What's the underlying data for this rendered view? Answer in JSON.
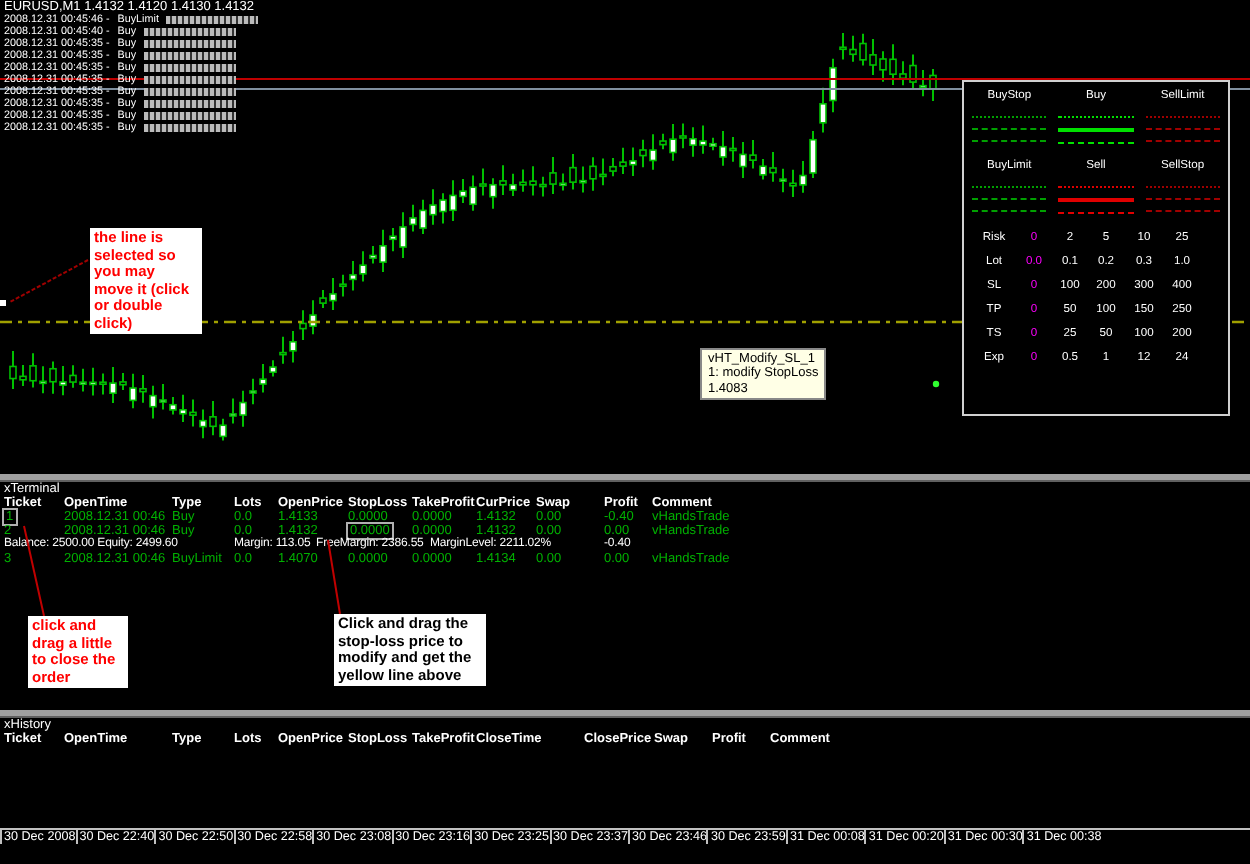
{
  "chart": {
    "header": "EURUSD,M1  1.4132 1.4120 1.4130 1.4132",
    "log": [
      {
        "time": "2008.12.31 00:45:46 -",
        "message": "BuyLimit"
      },
      {
        "time": "2008.12.31 00:45:40 -",
        "message": "Buy"
      },
      {
        "time": "2008.12.31 00:45:35 -",
        "message": "Buy"
      },
      {
        "time": "2008.12.31 00:45:35 -",
        "message": "Buy"
      },
      {
        "time": "2008.12.31 00:45:35 -",
        "message": "Buy"
      },
      {
        "time": "2008.12.31 00:45:35 -",
        "message": "Buy"
      },
      {
        "time": "2008.12.31 00:45:35 -",
        "message": "Buy"
      },
      {
        "time": "2008.12.31 00:45:35 -",
        "message": "Buy"
      },
      {
        "time": "2008.12.31 00:45:35 -",
        "message": "Buy"
      },
      {
        "time": "2008.12.31 00:45:35 -",
        "message": "Buy"
      }
    ],
    "notes": [
      {
        "kind": "callout",
        "color": "#ff0000",
        "text": "the line is selected so you may move it (click or double click)"
      },
      {
        "kind": "tooltip",
        "color": "#000000",
        "text": "vHT_Modify_SL_1\n1: modify StopLoss\n1.4083"
      }
    ],
    "panel": {
      "order_types": [
        {
          "label": "BuyStop",
          "color": "#00a000"
        },
        {
          "label": "Buy",
          "color": "#00e000"
        },
        {
          "label": "SellLimit",
          "color": "#a00000"
        },
        {
          "label": "BuyLimit",
          "color": "#00a000"
        },
        {
          "label": "Sell",
          "color": "#e00000"
        },
        {
          "label": "SellStop",
          "color": "#a00000"
        }
      ],
      "rows": [
        {
          "label": "Risk",
          "current": "0",
          "options": [
            "2",
            "5",
            "10",
            "25"
          ]
        },
        {
          "label": "Lot",
          "current": "0.0",
          "options": [
            "0.1",
            "0.2",
            "0.3",
            "1.0"
          ]
        },
        {
          "label": "SL",
          "current": "0",
          "options": [
            "100",
            "200",
            "300",
            "400"
          ]
        },
        {
          "label": "TP",
          "current": "0",
          "options": [
            "50",
            "100",
            "150",
            "250"
          ]
        },
        {
          "label": "TS",
          "current": "0",
          "options": [
            "25",
            "50",
            "100",
            "200"
          ]
        },
        {
          "label": "Exp",
          "current": "0",
          "options": [
            "0.5",
            "1",
            "12",
            "24"
          ]
        }
      ]
    }
  },
  "terminal": {
    "title": "xTerminal",
    "columns": [
      "Ticket",
      "OpenTime",
      "Type",
      "Lots",
      "OpenPrice",
      "StopLoss",
      "TakeProfit",
      "CurPrice",
      "Swap",
      "Profit",
      "Comment"
    ],
    "rows": [
      {
        "kind": "order",
        "cells": [
          {
            "text": "1",
            "outlined": true
          },
          "2008.12.31 00:46",
          "Buy",
          "0.0",
          "1.4133",
          "0.0000",
          "0.0000",
          "1.4132",
          "0.00",
          "-0.40",
          "vHandsTrade"
        ]
      },
      {
        "kind": "order",
        "cells": [
          "2",
          "2008.12.31 00:46",
          "Buy",
          "0.0",
          "1.4132",
          {
            "text": "0.0000",
            "outlined": true
          },
          "0.0000",
          "1.4132",
          "0.00",
          "0.00",
          "vHandsTrade"
        ]
      },
      {
        "kind": "summary",
        "texts": [
          "Balance: 2500.00  Equity: 2499.60",
          "Margin: 113.05",
          "FreeMargin: 2386.55",
          "MarginLevel: 2211.02%",
          "-0.40"
        ]
      },
      {
        "kind": "order",
        "cells": [
          "3",
          "2008.12.31 00:46",
          "BuyLimit",
          "0.0",
          "1.4070",
          "0.0000",
          "0.0000",
          "1.4134",
          "0.00",
          "0.00",
          "vHandsTrade"
        ]
      }
    ],
    "notes": [
      {
        "kind": "callout",
        "color": "#ff0000",
        "text": "click and drag a little to close the order"
      },
      {
        "kind": "callout",
        "color": "#000000",
        "text": "Click and drag the stop-loss price to modify and get the yellow line above"
      }
    ]
  },
  "history": {
    "title": "xHistory",
    "columns": [
      "Ticket",
      "OpenTime",
      "Type",
      "Lots",
      "OpenPrice",
      "StopLoss",
      "TakeProfit",
      "CloseTime",
      "ClosePrice",
      "Swap",
      "Profit",
      "Comment"
    ]
  },
  "time_axis": [
    "30 Dec 2008",
    "30 Dec 22:40",
    "30 Dec 22:50",
    "30 Dec 22:58",
    "30 Dec 23:08",
    "30 Dec 23:16",
    "30 Dec 23:25",
    "30 Dec 23:37",
    "30 Dec 23:46",
    "30 Dec 23:59",
    "31 Dec 00:08",
    "31 Dec 00:20",
    "31 Dec 00:30",
    "31 Dec 00:38"
  ]
}
